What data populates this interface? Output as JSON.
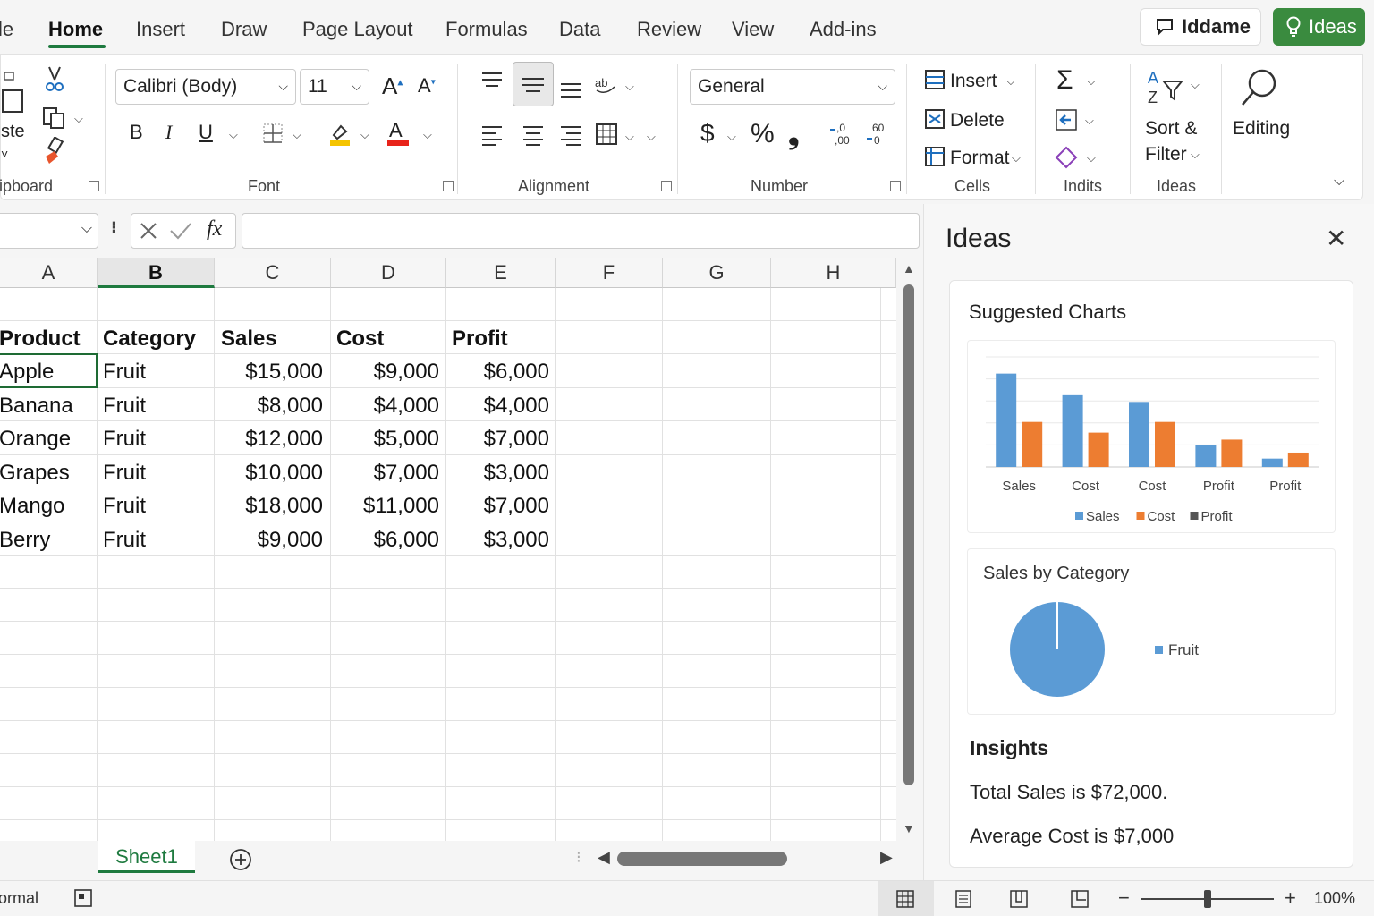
{
  "tabs": [
    "le",
    "Home",
    "Insert",
    "Draw",
    "Page Layout",
    "Formulas",
    "Data",
    "Review",
    "View",
    "Add-ins"
  ],
  "active_tab": "Home",
  "share_button": "Iddame",
  "ideas_button": "Ideas",
  "ribbon": {
    "clipboard": {
      "paste_label": "ste",
      "group_label": "ipboard"
    },
    "font": {
      "font_name": "Calibri (Body)",
      "font_size": "11",
      "group_label": "Font"
    },
    "alignment": {
      "group_label": "Alignment"
    },
    "number": {
      "format": "General",
      "currency": "$",
      "percent": "%",
      "comma": "❟",
      "group_label": "Number"
    },
    "cells": {
      "insert": "Insert",
      "delete": "Delete",
      "format": "Format",
      "group_label": "Cells"
    },
    "editing": {
      "sum": "Σ",
      "group_label": "Indits"
    },
    "ideas_group": {
      "sort_line1": "Sort &",
      "sort_line2": "Filter",
      "group_label": "Ideas"
    },
    "editing_btn": "Editing"
  },
  "formula_bar": {
    "fx": "fx",
    "value": ""
  },
  "columns": [
    "A",
    "B",
    "C",
    "D",
    "E",
    "F",
    "G",
    "H"
  ],
  "selected_column": "B",
  "table": {
    "headers": [
      "Product",
      "Category",
      "Sales",
      "Cost",
      "Profit"
    ],
    "rows": [
      [
        "Apple",
        "Fruit",
        "$15,000",
        "$9,000",
        "$6,000"
      ],
      [
        "Banana",
        "Fruit",
        "$8,000",
        "$4,000",
        "$4,000"
      ],
      [
        "Orange",
        "Fruit",
        "$12,000",
        "$5,000",
        "$7,000"
      ],
      [
        "Grapes",
        "Fruit",
        "$10,000",
        "$7,000",
        "$3,000"
      ],
      [
        "Mango",
        "Fruit",
        "$18,000",
        "$11,000",
        "$7,000"
      ],
      [
        "Berry",
        "Fruit",
        "$9,000",
        "$6,000",
        "$3,000"
      ]
    ]
  },
  "sheet_tab": "Sheet1",
  "status": {
    "mode": "ormal",
    "zoom": "100%"
  },
  "ideas_pane": {
    "title": "Ideas",
    "suggested_title": "Suggested Charts",
    "pie_title": "Sales by Category",
    "insights_title": "Insights",
    "insights": [
      "Total Sales is $72,000.",
      "Average Cost is $7,000"
    ]
  },
  "chart_data": [
    {
      "type": "bar",
      "categories": [
        "Sales",
        "Cost",
        "Cost",
        "Profit",
        "Profit"
      ],
      "series": [
        {
          "name": "Sales",
          "color": "#5b9bd5",
          "values": [
            28,
            21.5,
            19.5,
            6.5,
            2.5
          ]
        },
        {
          "name": "Cost",
          "color": "#ed7d31",
          "values": [
            13.5,
            10.3,
            13.5,
            8.2,
            4.3
          ]
        }
      ],
      "legend": [
        {
          "name": "Sales",
          "color": "#5b9bd5"
        },
        {
          "name": "Cost",
          "color": "#ed7d31"
        },
        {
          "name": "Profit",
          "color": "#555555"
        }
      ],
      "ylim": [
        0,
        33
      ],
      "grid": true,
      "legend_position": "bottom"
    },
    {
      "type": "pie",
      "title": "Sales by Category",
      "labels": [
        "Fruit"
      ],
      "values": [
        100
      ],
      "colors": [
        "#5b9bd5"
      ],
      "legend_position": "right"
    }
  ]
}
